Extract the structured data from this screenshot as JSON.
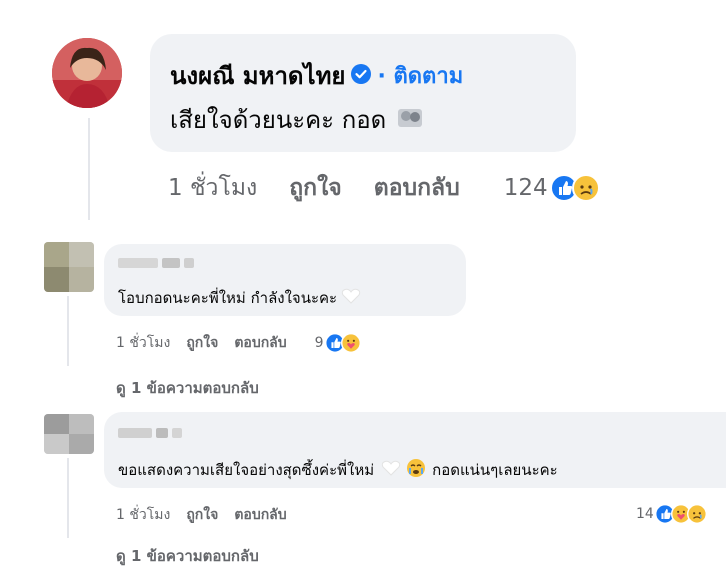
{
  "comments": [
    {
      "author": "นงผณี มหาดไทย",
      "follow_label": "· ติดตาม",
      "text": "เสียใจด้วยนะคะ กอด",
      "time": "1 ชั่วโมง",
      "like_label": "ถูกใจ",
      "reply_label": "ตอบกลับ",
      "reaction_count": "124"
    },
    {
      "text": "โอบกอดนะคะพี่ใหม่ กำลังใจนะคะ",
      "time": "1 ชั่วโมง",
      "like_label": "ถูกใจ",
      "reply_label": "ตอบกลับ",
      "reaction_count": "9",
      "view_replies": "ดู 1 ข้อความตอบกลับ"
    },
    {
      "text_part1": "ขอแสดงความเสียใจอย่างสุดซึ้งค่ะพี่ใหม่",
      "text_part2": "กอดแน่นๆเลยนะคะ",
      "time": "1 ชั่วโมง",
      "like_label": "ถูกใจ",
      "reply_label": "ตอบกลับ",
      "reaction_count": "14",
      "view_replies": "ดู 1 ข้อความตอบกลับ"
    }
  ],
  "colors": {
    "bubble": "#f0f2f5",
    "link": "#1877f2",
    "meta": "#65676b"
  }
}
